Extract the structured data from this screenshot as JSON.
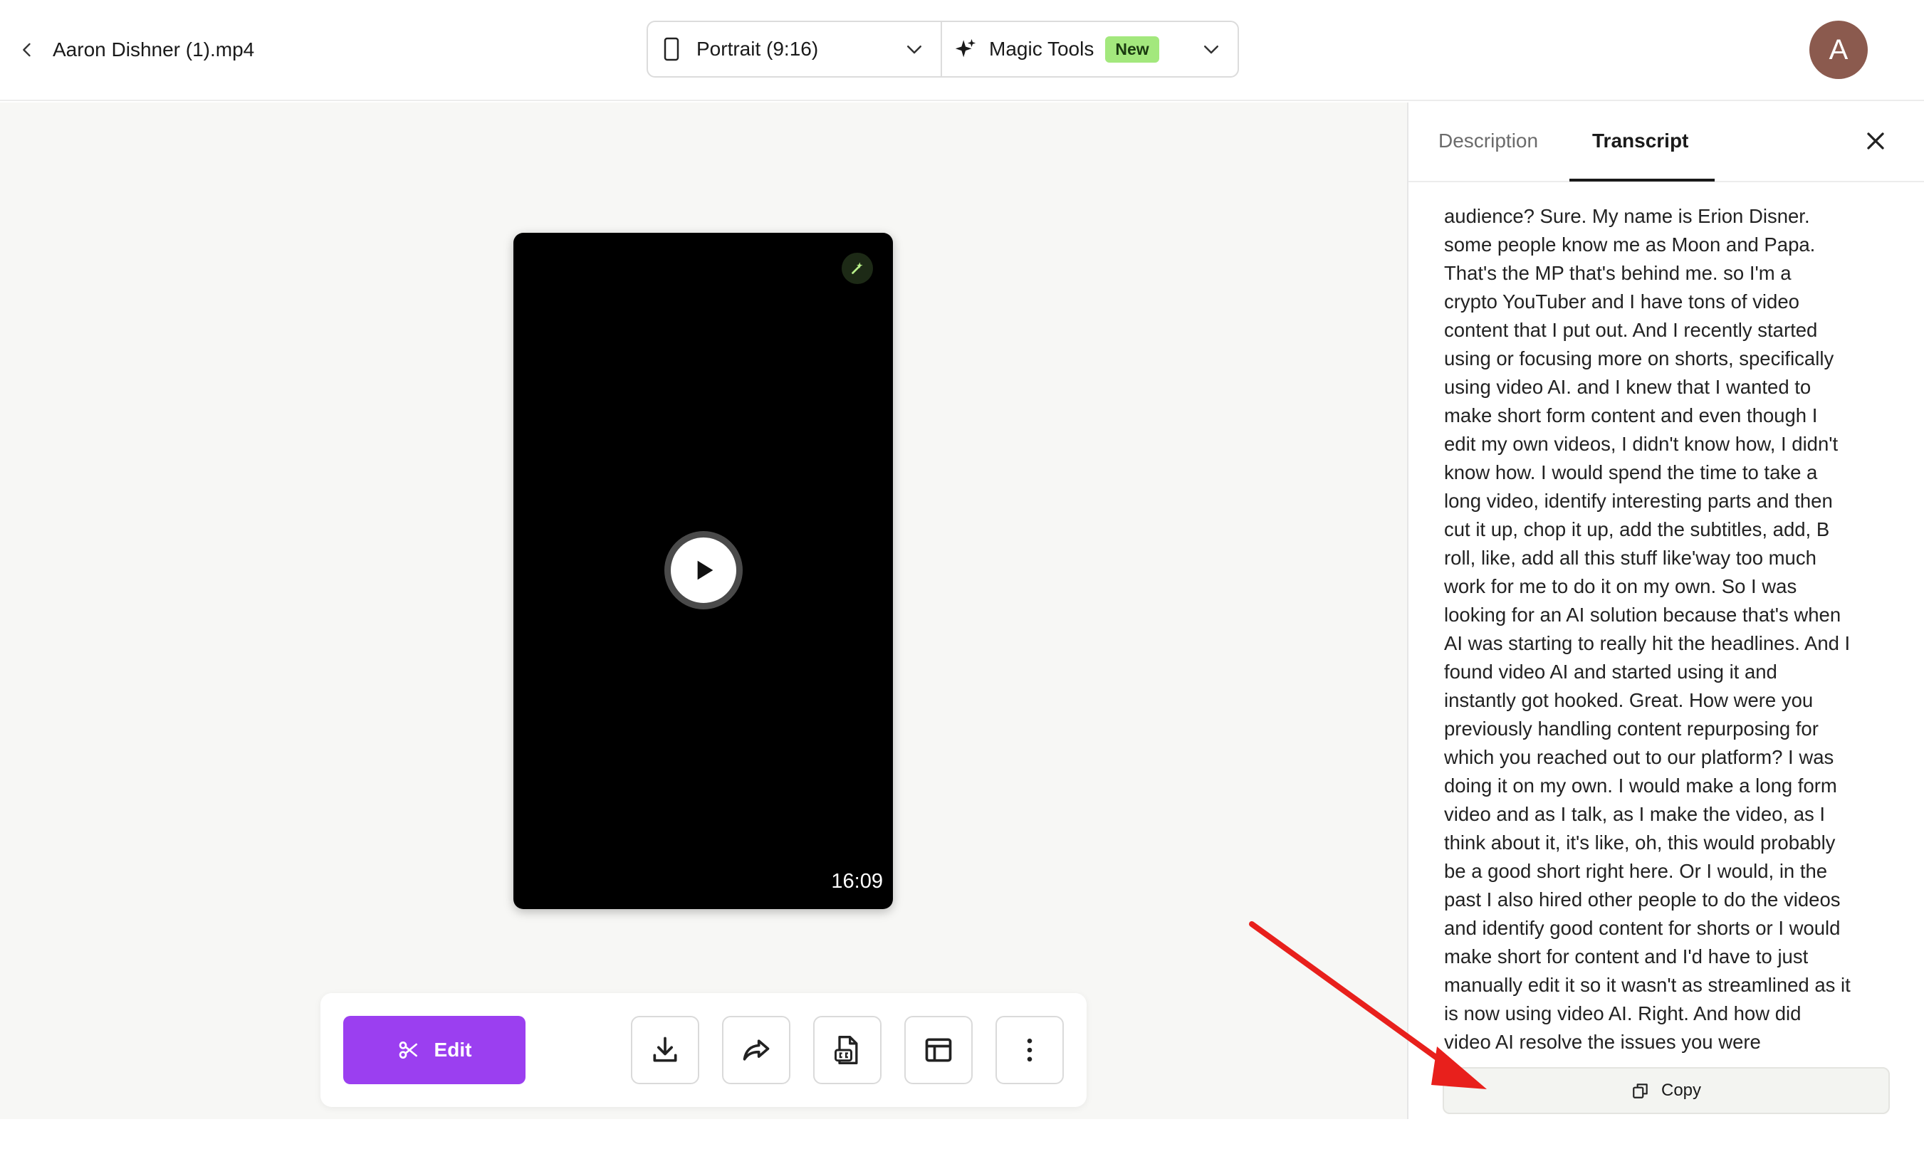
{
  "header": {
    "file_name": "Aaron Dishner (1).mp4",
    "aspect_label": "Portrait (9:16)",
    "magic_label": "Magic Tools",
    "new_badge": "New",
    "avatar_initial": "A"
  },
  "video": {
    "duration": "16:09"
  },
  "toolbar": {
    "edit_label": "Edit"
  },
  "panel": {
    "tabs": [
      "Description",
      "Transcript"
    ],
    "active_tab": "Transcript",
    "copy_label": "Copy",
    "transcript_lines": [
      "audience? Sure. My name is Erion Disner.",
      "some people know me as Moon and Papa.",
      "That's the MP that's behind me. so I'm a",
      "crypto YouTuber and I have tons of video",
      "content that I put out. And I recently started",
      "using or focusing more on shorts, specifically",
      "using video AI. and I knew that I wanted to",
      "make short form content and even though I",
      "edit my own videos, I didn't know how, I didn't",
      "know how. I would spend the time to take a",
      "long video, identify interesting parts and then",
      "cut it up, chop it up, add the subtitles, add, B",
      "roll, like, add all this stuff like'way too much",
      "work for me to do it on my own. So I was",
      "looking for an AI solution because that's when",
      "AI was starting to really hit the headlines. And I",
      "found video AI and started using it and",
      "instantly got hooked. Great. How were you",
      "previously handling content repurposing for",
      "which you reached out to our platform? I was",
      "doing it on my own. I would make a long form",
      "video and as I talk, as I make the video, as I",
      "think about it, it's like, oh, this would probably",
      "be a good short right here. Or I would, in the",
      "past I also hired other people to do the videos",
      "and identify good content for shorts or I would",
      "make short for content and I'd have to just",
      "manually edit it so it wasn't as streamlined as it",
      "is now using video AI. Right. And how did",
      "video AI resolve the issues you were"
    ]
  },
  "colors": {
    "accent_purple": "#9b3ff0",
    "new_badge_bg": "#a3e87d",
    "avatar_bg": "#8b5a4e",
    "annotation_arrow": "#e8201c"
  }
}
